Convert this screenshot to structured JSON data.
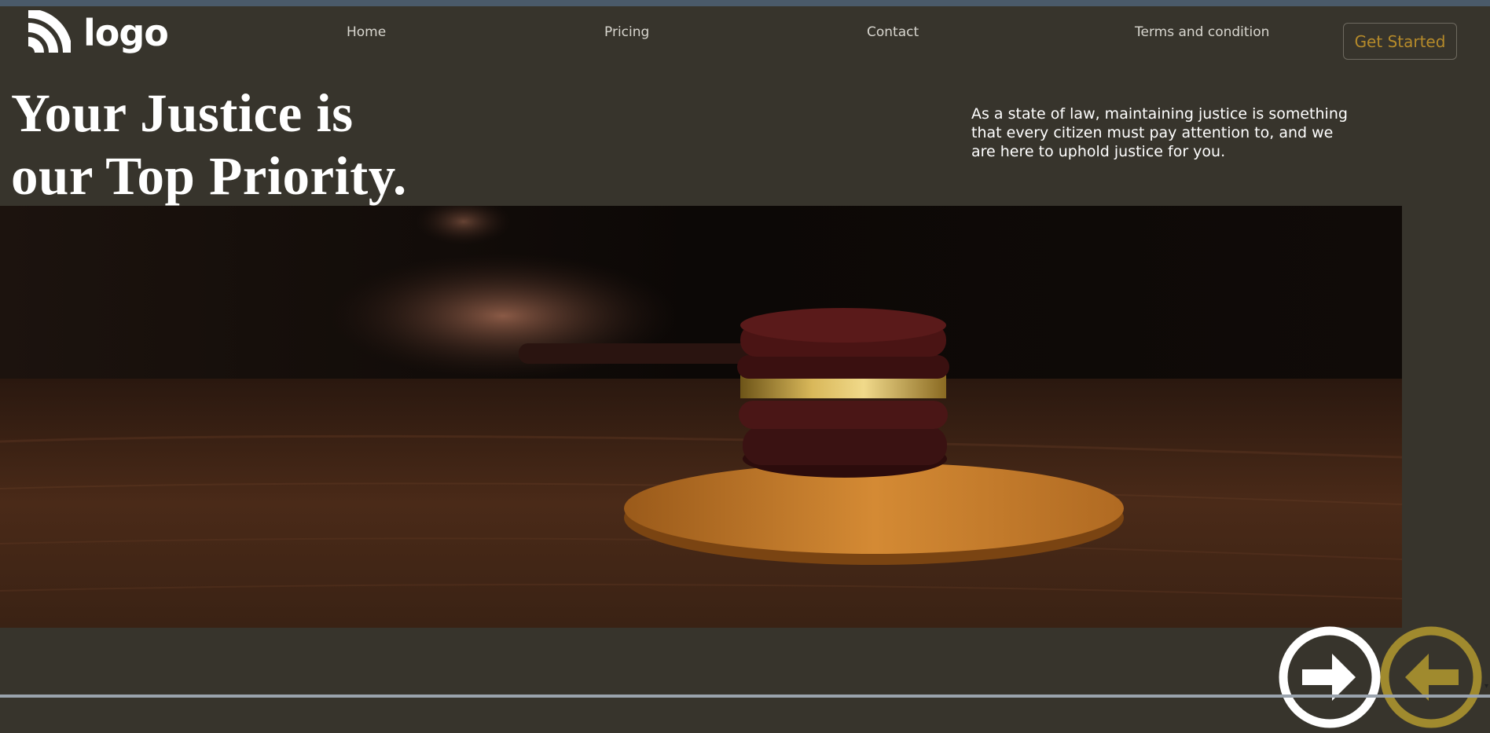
{
  "brand": {
    "logo_text": "logo",
    "icon": "wifi-arcs-logo-icon"
  },
  "nav": {
    "items": [
      {
        "label": "Home"
      },
      {
        "label": "Pricing"
      },
      {
        "label": "Contact"
      },
      {
        "label": "Terms and condition"
      }
    ],
    "cta_label": "Get Started"
  },
  "hero": {
    "headline_line1": "Your Justice is",
    "headline_line2": "our Top Priority.",
    "intro": "As a state of law, maintaining justice is something that every citizen must pay attention to, and we are here to uphold justice for you.",
    "image_subject": "judge-gavel-on-sound-block-photo"
  },
  "carousel": {
    "next_icon": "arrow-right-icon",
    "prev_icon": "arrow-left-icon"
  },
  "colors": {
    "background": "#37342c",
    "accent_gold": "#b58a2a",
    "text_light": "#ffffff",
    "nav_text": "#d8d6cf"
  }
}
